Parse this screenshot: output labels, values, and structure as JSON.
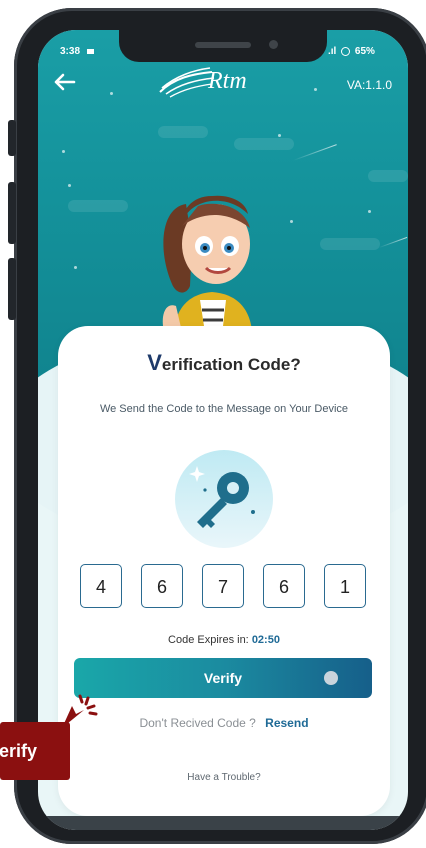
{
  "status_bar": {
    "time": "3:38",
    "battery": "65%",
    "signal": ".ıl"
  },
  "header": {
    "back_icon": "arrow-left-icon",
    "logo_text": "Rtm",
    "version": "VA:1.1.0"
  },
  "card": {
    "title_first_letter": "V",
    "title_rest": "erification Code?",
    "subtitle": "We Send the Code to the Message on Your Device",
    "otp_digits": [
      "4",
      "6",
      "7",
      "6",
      "1"
    ],
    "expires_label": "Code Expires in:",
    "expires_time": "02:50",
    "verify_label": "Verify",
    "not_received": "Don't Recived Code ?",
    "resend_label": "Resend",
    "trouble_label": "Have a Trouble?"
  },
  "overlay": {
    "callout_text": "Verify"
  },
  "colors": {
    "accent": "#1aa7a9",
    "dark_accent": "#165f8a",
    "callout": "#8b1010"
  }
}
